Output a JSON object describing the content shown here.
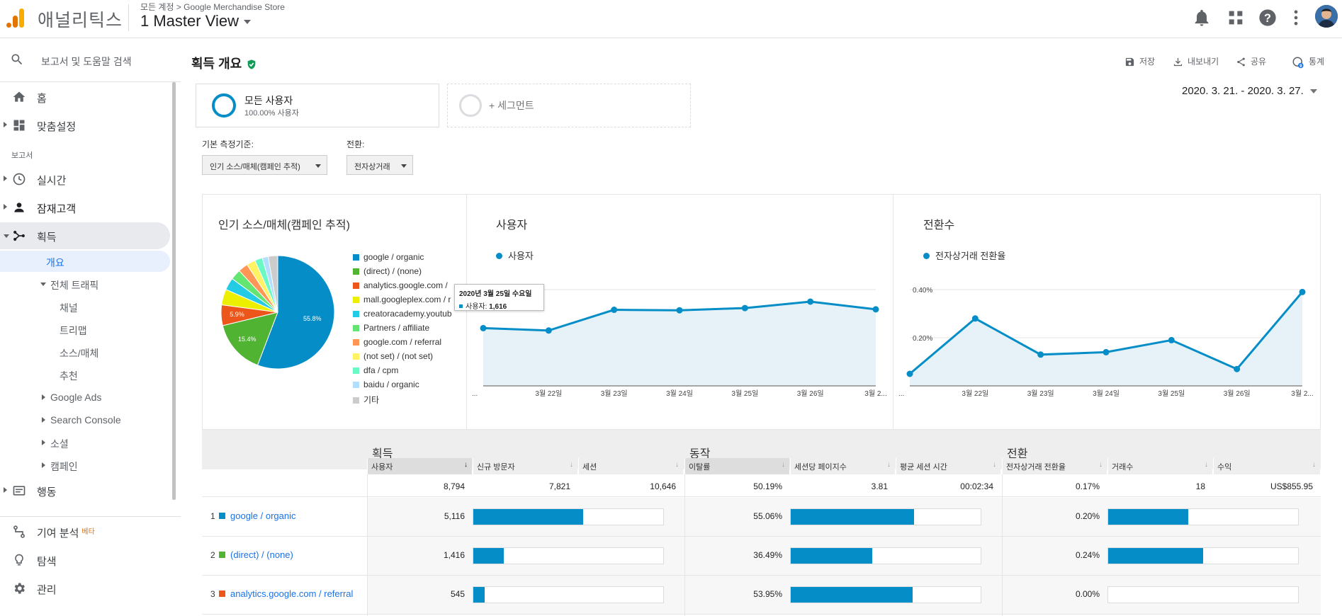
{
  "header": {
    "brand": "애널리틱스",
    "breadcrumb": "모든 계정 > Google Merchandise Store",
    "view": "1 Master View",
    "icons": [
      "bell-icon",
      "apps-icon",
      "help-icon",
      "more-icon"
    ],
    "accent": "#f9ab00"
  },
  "sidebar": {
    "search": "보고서 및 도움말 검색",
    "home": "홈",
    "customization": "맞춤설정",
    "section_label": "보고서",
    "realtime": "실시간",
    "audience": "잠재고객",
    "acquisition": "획득",
    "acq_sub": {
      "overview": "개요",
      "all_traffic": "전체 트래픽",
      "channels": "채널",
      "treemaps": "트리맵",
      "source_medium": "소스/매체",
      "referrals": "추천",
      "google_ads": "Google Ads",
      "search_console": "Search Console",
      "social": "소셜",
      "campaigns": "캠페인"
    },
    "behavior": "행동",
    "attribution": "기여 분석",
    "beta": "베타",
    "discover": "탐색",
    "admin": "관리"
  },
  "main": {
    "title": "획득 개요",
    "actions": {
      "save": "저장",
      "export": "내보내기",
      "share": "공유",
      "insights": "통계"
    },
    "segment": {
      "name": "모든 사용자",
      "sub": "100.00% 사용자",
      "add": "+ 세그먼트"
    },
    "date_range": "2020. 3. 21. - 2020. 3. 27.",
    "controls": {
      "primary_label": "기본 측정기준:",
      "primary_value": "인기 소스/매체(캠페인 추적)",
      "conversion_label": "전환:",
      "conversion_value": "전자상거래"
    }
  },
  "chart_data": [
    {
      "type": "pie",
      "title": "인기 소스/매체(캠페인 추적)",
      "labels": [
        "google / organic",
        "(direct) / (none)",
        "analytics.google.com / referral",
        "mall.googleplex.com / referral",
        "creatoracademy.youtube.com / referral",
        "Partners / affiliate",
        "google.com / referral",
        "(not set) / (not set)",
        "dfa / cpm",
        "baidu / organic",
        "기타"
      ],
      "legend_display": [
        "google / organic",
        "(direct) / (none)",
        "analytics.google.com /",
        "mall.googleplex.com / r",
        "creatoracademy.youtub",
        "Partners / affiliate",
        "google.com / referral",
        "(not set) / (not set)",
        "dfa / cpm",
        "baidu / organic",
        "기타"
      ],
      "values": [
        55.8,
        15.4,
        5.9,
        4.5,
        3.5,
        3.0,
        2.8,
        2.5,
        2.2,
        1.7,
        2.7
      ],
      "slice_labels": [
        "55.8%",
        "15.4%",
        "5.9%"
      ],
      "colors": [
        "#058dc7",
        "#50b432",
        "#ed561b",
        "#edef00",
        "#24cbe5",
        "#64e572",
        "#ff9655",
        "#fff263",
        "#6af9c4",
        "#b2deff",
        "#cccccc"
      ]
    },
    {
      "type": "area",
      "title": "사용자",
      "series": [
        {
          "name": "사용자",
          "values": [
            1200,
            1150,
            1580,
            1570,
            1616,
            1750,
            1590
          ]
        }
      ],
      "categories": [
        "...",
        "3월 22일",
        "3월 23일",
        "3월 24일",
        "3월 25일",
        "3월 26일",
        "3월 2..."
      ],
      "yticks": [
        "2,000",
        "1,000"
      ],
      "ylim": [
        0,
        2000
      ],
      "color": "#058dc7"
    },
    {
      "type": "area",
      "title": "전환수",
      "series": [
        {
          "name": "전자상거래 전환율",
          "values": [
            0.05,
            0.28,
            0.13,
            0.14,
            0.19,
            0.07,
            0.39
          ]
        }
      ],
      "categories": [
        "...",
        "3월 22일",
        "3월 23일",
        "3월 24일",
        "3월 25일",
        "3월 26일",
        "3월 2..."
      ],
      "yticks": [
        "0.40%",
        "0.20%"
      ],
      "ylim": [
        0,
        0.4
      ],
      "color": "#058dc7"
    }
  ],
  "tooltip": {
    "date": "2020년 3월 25일 수요일",
    "label": "사용자:",
    "value": "1,616"
  },
  "table": {
    "groups": [
      "획득",
      "동작",
      "전환"
    ],
    "columns": [
      "사용자",
      "신규 방문자",
      "세션",
      "이탈률",
      "세션당 페이지수",
      "평균 세션 시간",
      "전자상거래 전환율",
      "거래수",
      "수익"
    ],
    "totals": [
      "8,794",
      "7,821",
      "10,646",
      "50.19%",
      "3.81",
      "00:02:34",
      "0.17%",
      "18",
      "US$855.95"
    ],
    "rows": [
      {
        "num": "1",
        "name": "google / organic",
        "color": "#058dc7",
        "users": "5,116",
        "users_pct": 58,
        "bounce": "55.06%",
        "bounce_pct": 65,
        "conv": "0.20%",
        "conv_pct": 42
      },
      {
        "num": "2",
        "name": "(direct) / (none)",
        "color": "#50b432",
        "users": "1,416",
        "users_pct": 16,
        "bounce": "36.49%",
        "bounce_pct": 43,
        "conv": "0.24%",
        "conv_pct": 50
      },
      {
        "num": "3",
        "name": "analytics.google.com / referral",
        "color": "#ed561b",
        "users": "545",
        "users_pct": 6,
        "bounce": "53.95%",
        "bounce_pct": 64,
        "conv": "0.00%",
        "conv_pct": 0
      }
    ]
  }
}
